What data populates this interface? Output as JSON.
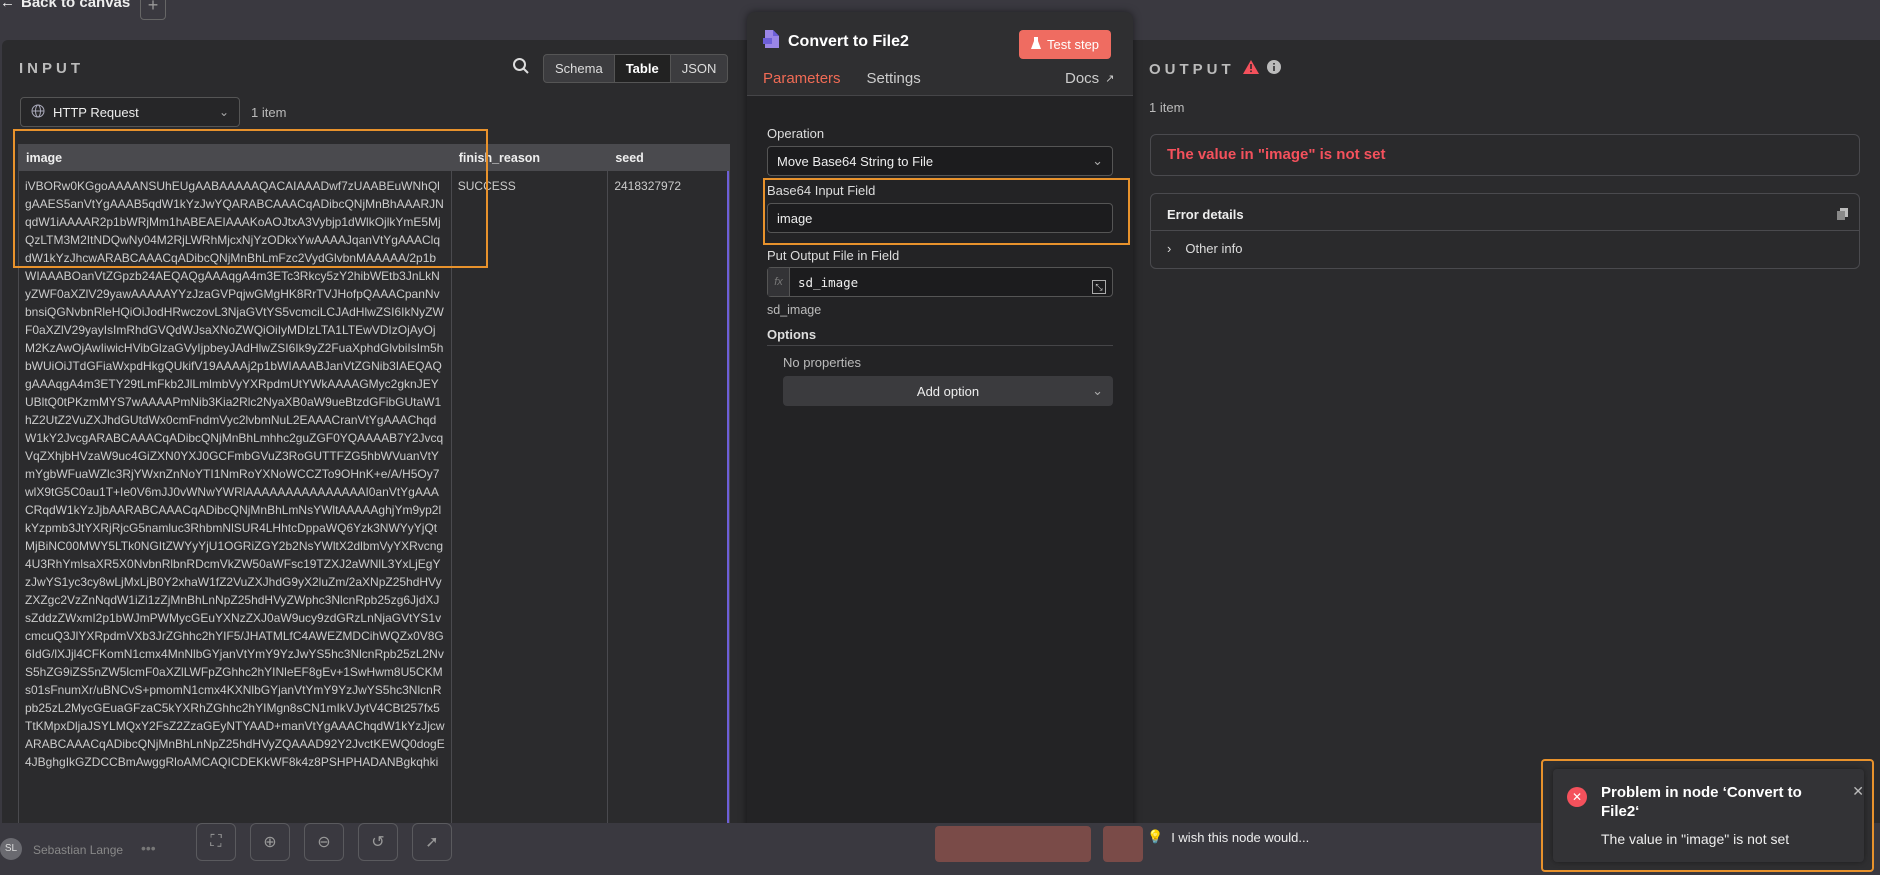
{
  "topbar": {
    "back_label": "Back to canvas",
    "plus": "+"
  },
  "input": {
    "title": "INPUT",
    "views": [
      "Schema",
      "Table",
      "JSON"
    ],
    "active_view": "Table",
    "node_select": "HTTP Request",
    "item_count": "1 item",
    "columns": [
      "image",
      "finish_reason",
      "seed"
    ],
    "row": {
      "image": "iVBORw0KGgoAAAANSUhEUgAABAAAAAQACAIAAADwf7zUAABEuWNhQlgAAES5anVtYgAAAB5qdW1kYzJwYQARABCAAACqADibcQNjMnBhAAARJNqdW1iAAAAR2p1bWRjMm1hABEAEIAAAKoAOJtxA3Vybjp1dWlkOjlkYmE5MjQzLTM3M2ItNDQwNy04M2RjLWRhMjcxNjYzODkxYwAAAAJqanVtYgAAAClqdW1kYzJhcwARABCAAACqADibcQNjMnBhLmFzc2VydGlvbnMAAAAA/2p1bWIAAABOanVtZGpzb24AEQAQgAAAqgA4m3ETc3Rkcy5zY2hibWEtb3JnLkNyZWF0aXZlV29yawAAAAAYYzJzaGVPqjwGMgHK8RrTVJHofpQAAACpanNvbnsiQGNvbnRleHQiOiJodHRwczovL3NjaGVtYS5vcmciLCJAdHlwZSI6IkNyZWF0aXZlV29yayIsImRhdGVQdWJsaXNoZWQiOiIyMDIzLTA1LTEwVDIzOjAyOjM2KzAwOjAwIiwicHVibGlzaGVyIjpbeyJAdHlwZSI6Ik9yZ2FuaXphdGlvbiIsIm5hbWUiOiJTdGFiaWxpdHkgQUkifV19AAAAj2p1bWIAAABJanVtZGNib3IAEQAQgAAAqgA4m3ETY29tLmFkb2JlLmlmbVyYXRpdmUtYWkAAAAGMyc2gknJEYUBltQ0tPKzmMYS7wAAAAPmNib3Kia2Rlc2NyaXB0aW9ueBtzdGFibGUtaW1hZ2UtZ2VuZXJhdGUtdWx0cmFndmVyc2lvbmNuL2EAAACranVtYgAAAChqdW1kY2JvcgARABCAAACqADibcQNjMnBhLmhhc2guZGF0YQAAAAB7Y2JvcqVqZXhjbHVzaW9uc4GiZXN0YXJ0GCFmbGVuZ3RoGUTTFZG5hbWVuanVtYmYgbWFuaWZlc3RjYWxnZnNoYTI1NmRoYXNoWCCZTo9OHnK+e/A/H5Oy7wlX9tG5C0au1T+Ie0V6mJJ0vWNwYWRlAAAAAAAAAAAAAAAI0anVtYgAAACRqdW1kYzJjbAARABCAAACqADibcQNjMnBhLmNsYWltAAAAAghjYm9yp2lkYzpmb3JtYXRjRjcG5namluc3RhbmNlSUR4LHhtcDppaWQ6Yzk3NWYyYjQtMjBiNC00MWY5LTk0NGItZWYyYjU1OGRiZGY2b2NsYWltX2dlbmVyYXRvcng4U3RhYmlsaXR5X0NvbnRlbnRDcmVkZW50aWFsc19TZXJ2aWNlL3YxLjEgYzJwYS1yc3cy8wLjMxLjB0Y2xhaW1fZ2VuZXJhdG9yX2luZm/2aXNpZ25hdHVyZXZgc2VzZnNqdW1iZi1zZjMnBhLnNpZ25hdHVyZWphc3NlcnRpb25zg6JjdXJsZddzZWxmI2p1bWJmPWMycGEuYXNzZXJ0aW9ucy9zdGRzLnNjaGVtYS1vcmcuQ3JlYXRpdmVXb3JrZGhhc2hYIF5/JHATMLfC4AWEZMDCihWQZx0V8G6IdG/lXJjl4CFKomN1cmx4MnNlbGYjanVtYmY9YzJwYS5hc3NlcnRpb25zL2NvS5hZG9iZS5nZW5lcmF0aXZlLWFpZGhhc2hYINleEF8gEv+1SwHwm8U5CKMs01sFnumXr/uBNCvS+pmomN1cmx4KXNlbGYjanVtYmY9YzJwYS5hc3NlcnRpb25zL2MycGEuaGFzaC5kYXRhZGhhc2hYIMgn8sCN1mIkVJytV4CBt257fx5TtKMpxDljaJSYLMQxY2FsZ2ZzaGEyNTYAAD+manVtYgAAAChqdW1kYzJjcwARABCAAACqADibcQNjMnBhLnNpZ25hdHVyZQAAAD92Y2JvctKEWQ0dogE4JBghgIkGZDCCBmAwggRloAMCAQICDEKkWF8k4z8PSHPHADANBgkqhki",
      "finish_reason": "SUCCESS",
      "seed": "2418327972"
    }
  },
  "node": {
    "title": "Convert to File2",
    "test_step": "Test step",
    "tabs": [
      "Parameters",
      "Settings"
    ],
    "active_tab": "Parameters",
    "docs": "Docs",
    "operation_label": "Operation",
    "operation_value": "Move Base64 String to File",
    "base64_label": "Base64 Input Field",
    "base64_value": "image",
    "output_field_label": "Put Output File in Field",
    "output_field_value": "sd_image",
    "output_field_hint": "sd_image",
    "fx": "fx",
    "options_label": "Options",
    "no_properties": "No properties",
    "add_option": "Add option"
  },
  "output": {
    "title": "OUTPUT",
    "item_count": "1 item",
    "error_message": "The value in \"image\" is not set",
    "error_details": "Error details",
    "other_info": "Other info"
  },
  "bottom": {
    "user_initials": "SL",
    "user_name": "Sebastian Lange",
    "wish": "I wish this node would..."
  },
  "toast": {
    "title": "Problem in node ‘Convert to File2‘",
    "message": "The value in \"image\" is not set"
  },
  "colors": {
    "accent": "#f06b55",
    "error": "#f4515c",
    "highlight": "#e8922c",
    "table_selection": "#6d5fd8"
  }
}
